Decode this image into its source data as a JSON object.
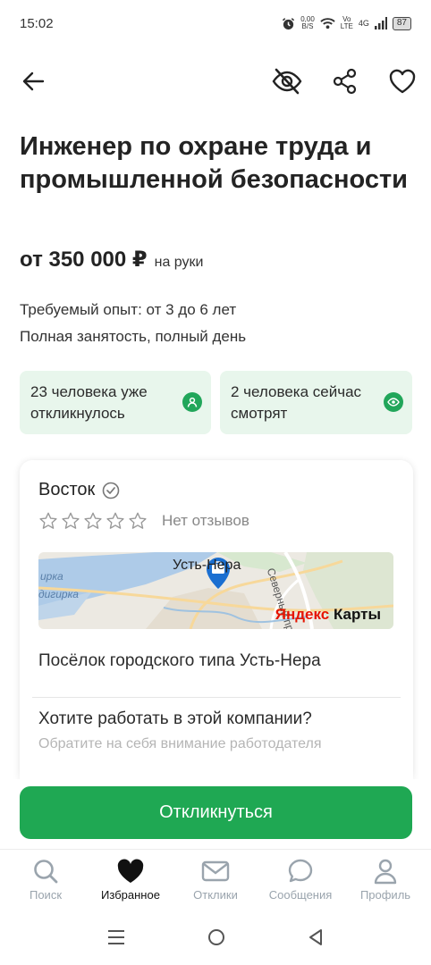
{
  "status_bar": {
    "time": "15:02",
    "data_rate_top": "0,00",
    "data_rate_bottom": "B/S",
    "volte_top": "Vo",
    "volte_bottom": "LTE",
    "network": "4G",
    "battery": "87"
  },
  "toolbar": {
    "back_icon": "arrow-left-icon",
    "hide_icon": "eye-off-icon",
    "share_icon": "share-icon",
    "favorite_icon": "heart-outline-icon"
  },
  "vacancy": {
    "title": "Инженер по охране труда и промышленной безопасности",
    "salary": "от 350 000 ₽",
    "salary_note": "на руки",
    "experience": "Требуемый опыт: от 3 до 6 лет",
    "employment": "Полная занятость, полный день"
  },
  "stats": [
    {
      "text": "23 человека уже откликнулось",
      "icon": "person-icon"
    },
    {
      "text": "2 человека сейчас смотрят",
      "icon": "eye-icon"
    }
  ],
  "company": {
    "name": "Восток",
    "verified_icon": "check-circle-icon",
    "stars_count": 5,
    "rating": 0,
    "reviews": "Нет отзывов",
    "map": {
      "town_label": "Усть-Нера",
      "river_label_1": "ирка",
      "river_label_2": "дигирка",
      "street_label": "Северный пр-т",
      "brand_prefix": "Яндекс",
      "brand_suffix": " Карты"
    },
    "address": "Посёлок городского типа Усть-Нера",
    "want_title": "Хотите работать в этой компании?",
    "want_subtitle": "Обратите на себя внимание работодателя"
  },
  "apply_button": "Откликнуться",
  "bottom_nav": [
    {
      "label": "Поиск",
      "icon": "search-icon",
      "active": false
    },
    {
      "label": "Избранное",
      "icon": "heart-filled-icon",
      "active": true
    },
    {
      "label": "Отклики",
      "icon": "mail-icon",
      "active": false
    },
    {
      "label": "Сообщения",
      "icon": "chat-icon",
      "active": false
    },
    {
      "label": "Профиль",
      "icon": "profile-icon",
      "active": false
    }
  ],
  "colors": {
    "accent": "#1fa853",
    "stat_background": "#e8f6ec",
    "nav_inactive": "#9aa4ad"
  }
}
